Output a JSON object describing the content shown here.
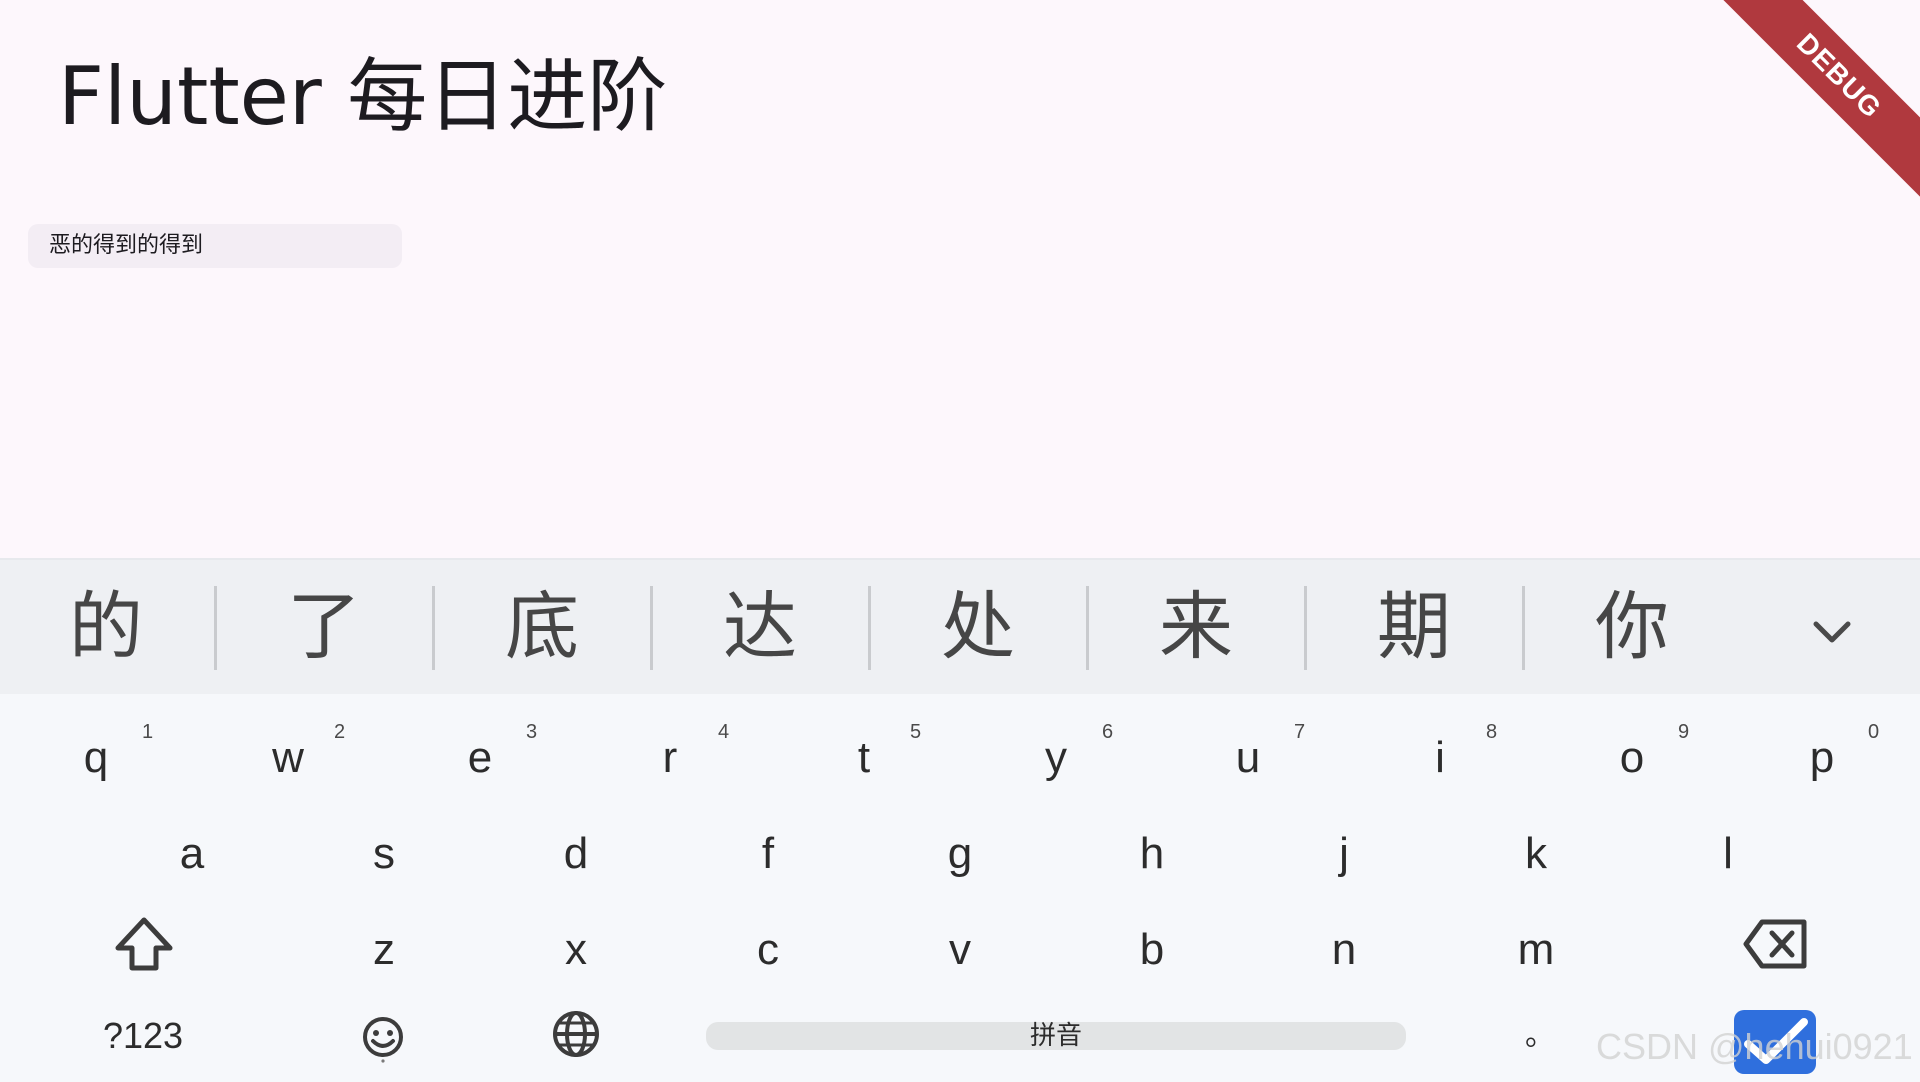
{
  "app": {
    "title": "Flutter 每日进阶",
    "debug_banner": "DEBUG"
  },
  "text_field": {
    "value": "恶的得到的得到"
  },
  "keyboard": {
    "candidates": [
      "的",
      "了",
      "底",
      "达",
      "处",
      "来",
      "期",
      "你"
    ],
    "row1": [
      {
        "key": "q",
        "hint": "1"
      },
      {
        "key": "w",
        "hint": "2"
      },
      {
        "key": "e",
        "hint": "3"
      },
      {
        "key": "r",
        "hint": "4"
      },
      {
        "key": "t",
        "hint": "5"
      },
      {
        "key": "y",
        "hint": "6"
      },
      {
        "key": "u",
        "hint": "7"
      },
      {
        "key": "i",
        "hint": "8"
      },
      {
        "key": "o",
        "hint": "9"
      },
      {
        "key": "p",
        "hint": "0"
      }
    ],
    "row2": [
      "a",
      "s",
      "d",
      "f",
      "g",
      "h",
      "j",
      "k",
      "l"
    ],
    "row3": [
      "z",
      "x",
      "c",
      "v",
      "b",
      "n",
      "m"
    ],
    "symbols_label": "?123",
    "space_label": "拼音",
    "period_label": "。",
    "icons": {
      "expand": "chevron-down-icon",
      "shift": "shift-icon",
      "backspace": "backspace-icon",
      "emoji": "emoji-icon",
      "language": "globe-icon",
      "done": "checkmark-icon"
    },
    "accent_color": "#2f6fdd"
  },
  "watermark": "CSDN @hehui0921"
}
